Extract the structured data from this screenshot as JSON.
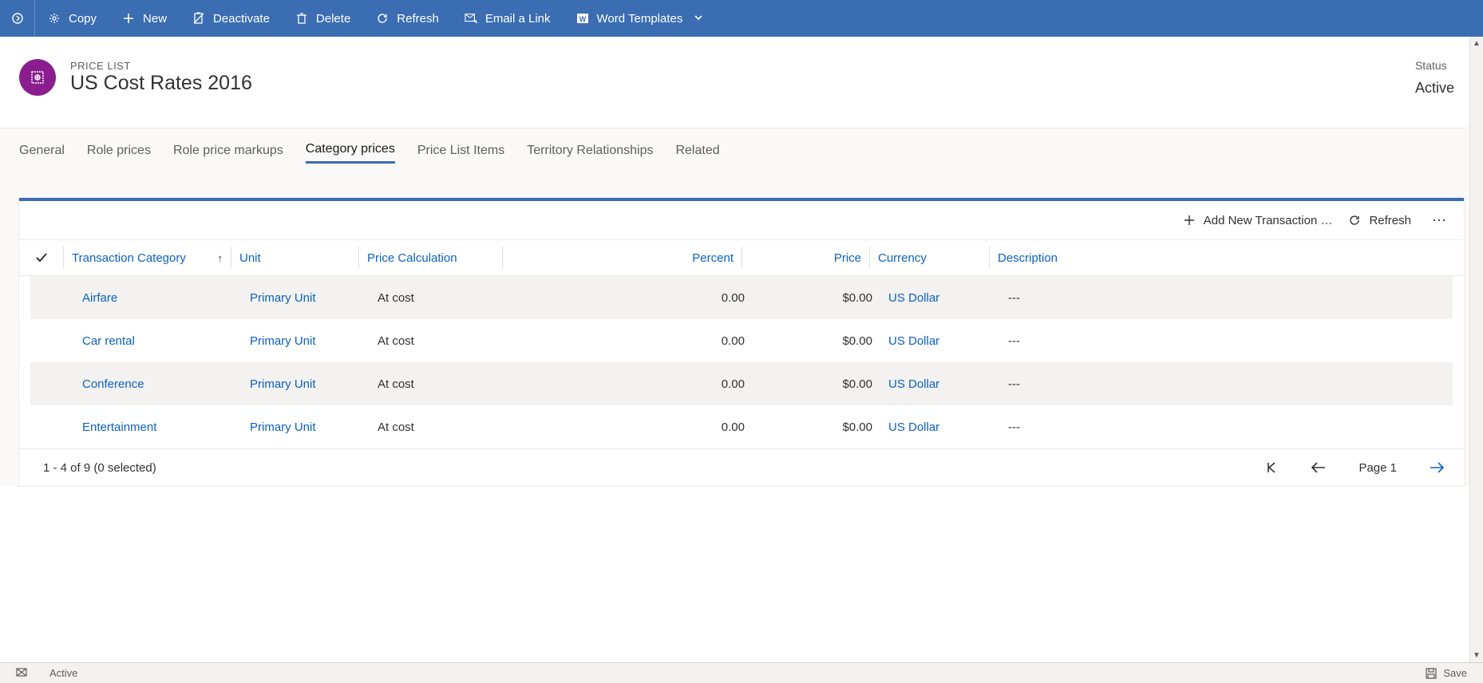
{
  "commandBar": {
    "copy": "Copy",
    "new": "New",
    "deactivate": "Deactivate",
    "delete": "Delete",
    "refresh": "Refresh",
    "emailLink": "Email a Link",
    "wordTemplates": "Word Templates"
  },
  "header": {
    "entity": "PRICE LIST",
    "name": "US Cost Rates 2016",
    "statusLabel": "Status",
    "statusValue": "Active"
  },
  "tabs": {
    "general": "General",
    "rolePrices": "Role prices",
    "roleMarkups": "Role price markups",
    "categoryPrices": "Category prices",
    "priceListItems": "Price List Items",
    "territory": "Territory Relationships",
    "related": "Related"
  },
  "gridToolbar": {
    "addNew": "Add New Transaction …",
    "refresh": "Refresh"
  },
  "columns": {
    "category": "Transaction Category",
    "unit": "Unit",
    "calc": "Price Calculation",
    "percent": "Percent",
    "price": "Price",
    "currency": "Currency",
    "description": "Description"
  },
  "rows": [
    {
      "category": "Airfare",
      "unit": "Primary Unit",
      "calc": "At cost",
      "percent": "0.00",
      "price": "$0.00",
      "currency": "US Dollar",
      "description": "---"
    },
    {
      "category": "Car rental",
      "unit": "Primary Unit",
      "calc": "At cost",
      "percent": "0.00",
      "price": "$0.00",
      "currency": "US Dollar",
      "description": "---"
    },
    {
      "category": "Conference",
      "unit": "Primary Unit",
      "calc": "At cost",
      "percent": "0.00",
      "price": "$0.00",
      "currency": "US Dollar",
      "description": "---"
    },
    {
      "category": "Entertainment",
      "unit": "Primary Unit",
      "calc": "At cost",
      "percent": "0.00",
      "price": "$0.00",
      "currency": "US Dollar",
      "description": "---"
    }
  ],
  "pager": {
    "summary": "1 - 4 of 9 (0 selected)",
    "pageLabel": "Page 1"
  },
  "footer": {
    "status": "Active",
    "save": "Save"
  }
}
